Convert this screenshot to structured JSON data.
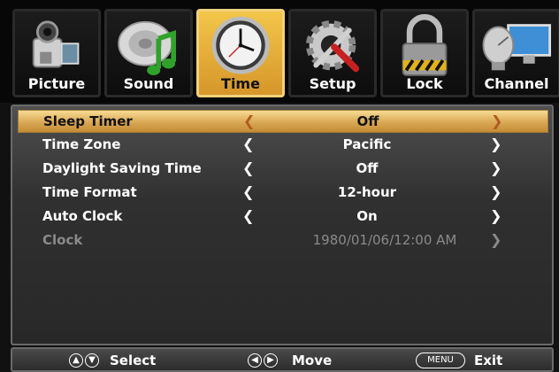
{
  "tabs": [
    {
      "label": "Picture",
      "icon": "camcorder-icon",
      "active": false
    },
    {
      "label": "Sound",
      "icon": "speaker-note-icon",
      "active": false
    },
    {
      "label": "Time",
      "icon": "clock-icon",
      "active": true
    },
    {
      "label": "Setup",
      "icon": "gear-tools-icon",
      "active": false
    },
    {
      "label": "Lock",
      "icon": "padlock-icon",
      "active": false
    },
    {
      "label": "Channel",
      "icon": "satellite-monitor-icon",
      "active": false
    }
  ],
  "menu": {
    "rows": [
      {
        "label": "Sleep Timer",
        "value": "Off",
        "selected": true,
        "disabled": false
      },
      {
        "label": "Time Zone",
        "value": "Pacific",
        "selected": false,
        "disabled": false
      },
      {
        "label": "Daylight Saving Time",
        "value": "Off",
        "selected": false,
        "disabled": false
      },
      {
        "label": "Time Format",
        "value": "12-hour",
        "selected": false,
        "disabled": false
      },
      {
        "label": "Auto Clock",
        "value": "On",
        "selected": false,
        "disabled": false
      },
      {
        "label": "Clock",
        "value": "1980/01/06/12:00 AM",
        "selected": false,
        "disabled": true
      }
    ]
  },
  "footer": {
    "select_label": "Select",
    "move_label": "Move",
    "menu_key": "MENU",
    "exit_label": "Exit"
  },
  "colors": {
    "active_tab": "#e8b03c",
    "selected_row": "#d9a855",
    "disabled_text": "#8a8a8a"
  }
}
